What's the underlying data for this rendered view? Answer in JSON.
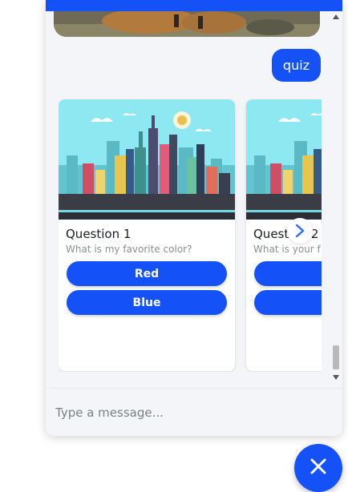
{
  "colors": {
    "accent": "#1452f7",
    "background": "#f3f5f8",
    "card": "#ffffff"
  },
  "conversation": {
    "user_message": "quiz"
  },
  "carousel": {
    "cards": [
      {
        "title": "Question 1",
        "subtitle": "What is my favorite color?",
        "buttons": [
          "Red",
          "Blue"
        ],
        "image": "city-skyline-illustration"
      },
      {
        "title": "Question 2",
        "subtitle": "What is your f",
        "buttons": [
          "",
          ""
        ],
        "image": "city-skyline-illustration"
      }
    ],
    "next_icon": "chevron-right-icon"
  },
  "composer": {
    "placeholder": "Type a message..."
  },
  "fab": {
    "icon": "close-icon"
  }
}
